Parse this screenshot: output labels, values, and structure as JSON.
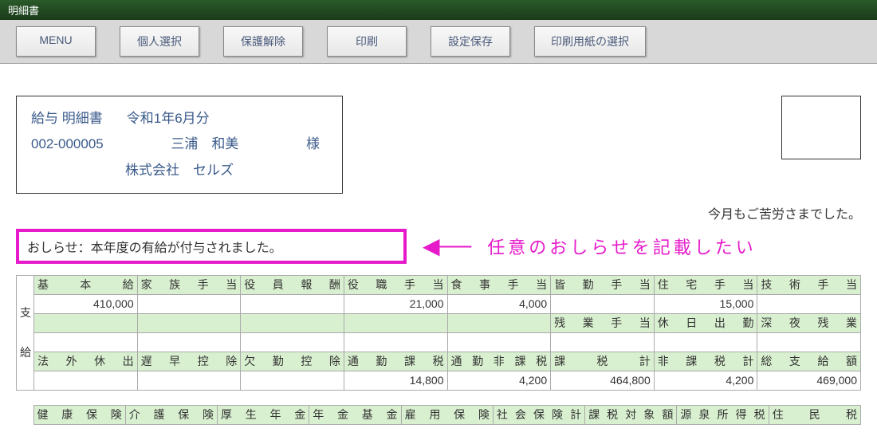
{
  "titlebar": {
    "title": "明細書"
  },
  "toolbar": {
    "menu": "MENU",
    "select_person": "個人選択",
    "unprotect": "保護解除",
    "print": "印刷",
    "save_settings": "設定保存",
    "select_paper": "印刷用紙の選択"
  },
  "header": {
    "doc_title": "給与 明細書",
    "period": "令和1年6月分",
    "emp_code": "002-000005",
    "emp_name": "三浦　和美",
    "honorific": "様",
    "company": "株式会社　セルズ"
  },
  "footer_msg": "今月もご苦労さまでした。",
  "notice": {
    "text": "おしらせ：本年度の有給が付与されました。",
    "annotation": "任意のおしらせを記載したい"
  },
  "pay": {
    "cols1": [
      "基本給",
      "家族手当",
      "役員報酬",
      "役職手当",
      "食事手当",
      "皆勤手当",
      "住宅手当",
      "技術手当"
    ],
    "vals1": [
      "410,000",
      "",
      "",
      "21,000",
      "4,000",
      "",
      "15,000",
      ""
    ],
    "cols2": [
      "",
      "",
      "",
      "",
      "",
      "残業手当",
      "休日出勤",
      "深夜残業"
    ],
    "vals2": [
      "",
      "",
      "",
      "",
      "",
      "",
      "",
      ""
    ],
    "cols3": [
      "法外休出",
      "遅早控除",
      "欠勤控除",
      "通勤課税",
      "通勤非課税",
      "課税計",
      "非課税計",
      "総支給額"
    ],
    "vals3": [
      "",
      "",
      "",
      "14,800",
      "4,200",
      "464,800",
      "4,200",
      "469,000"
    ],
    "side_label_1": "支",
    "side_label_2": "給"
  },
  "ded": {
    "cols1": [
      "健康保険",
      "介護保険",
      "厚生年金",
      "年金基金",
      "雇用保険",
      "社会保険計",
      "課税対象額",
      "源泉所得税",
      "住民税"
    ]
  }
}
